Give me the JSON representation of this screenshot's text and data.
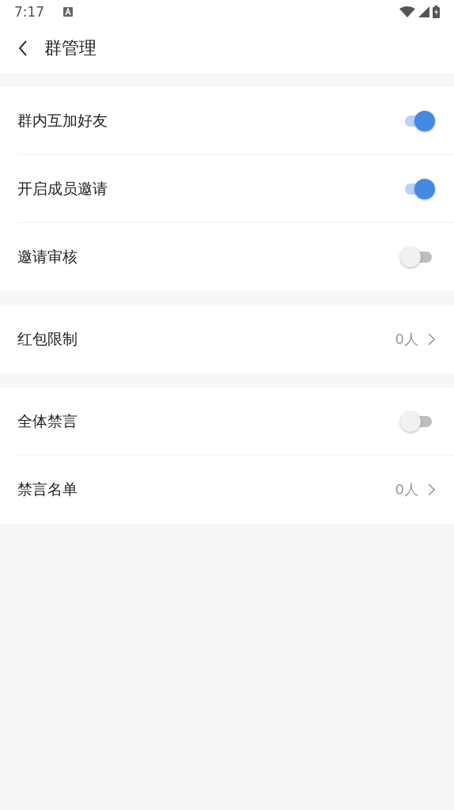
{
  "status_bar": {
    "time": "7:17"
  },
  "header": {
    "title": "群管理"
  },
  "groups": [
    {
      "rows": [
        {
          "kind": "toggle",
          "label": "群内互加好友",
          "on": true
        },
        {
          "kind": "toggle",
          "label": "开启成员邀请",
          "on": true
        },
        {
          "kind": "toggle",
          "label": "邀请审核",
          "on": false
        }
      ]
    },
    {
      "rows": [
        {
          "kind": "link",
          "label": "红包限制",
          "value": "0人"
        }
      ]
    },
    {
      "rows": [
        {
          "kind": "toggle",
          "label": "全体禁言",
          "on": false
        },
        {
          "kind": "link",
          "label": "禁言名单",
          "value": "0人"
        }
      ]
    }
  ]
}
